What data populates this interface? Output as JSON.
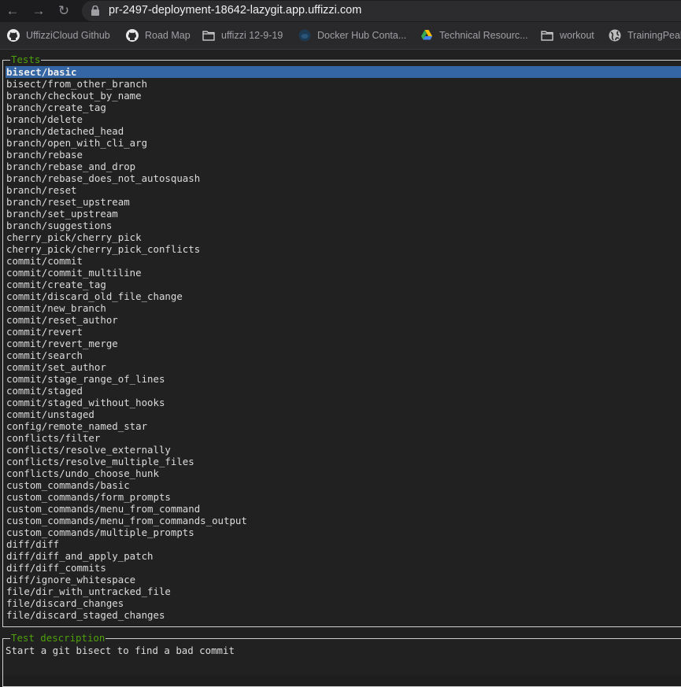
{
  "browser": {
    "url": "pr-2497-deployment-18642-lazygit.app.uffizzi.com",
    "nav": {
      "back": "back-icon",
      "forward": "forward-icon",
      "reload": "reload-icon"
    },
    "bookmarks": [
      {
        "label": "UffizziCloud Github",
        "icon": "github-icon"
      },
      {
        "label": "Road Map",
        "icon": "github-icon"
      },
      {
        "label": "uffizzi 12-9-19",
        "icon": "folder-icon"
      },
      {
        "label": "Docker Hub Conta...",
        "icon": "docker-icon"
      },
      {
        "label": "Technical Resourc...",
        "icon": "google-drive-icon"
      },
      {
        "label": "workout",
        "icon": "folder-icon"
      },
      {
        "label": "TrainingPeaks",
        "icon": "globe-icon"
      }
    ]
  },
  "tests_panel": {
    "title": "Tests",
    "selected_index": 0,
    "items": [
      "bisect/basic",
      "bisect/from_other_branch",
      "branch/checkout_by_name",
      "branch/create_tag",
      "branch/delete",
      "branch/detached_head",
      "branch/open_with_cli_arg",
      "branch/rebase",
      "branch/rebase_and_drop",
      "branch/rebase_does_not_autosquash",
      "branch/reset",
      "branch/reset_upstream",
      "branch/set_upstream",
      "branch/suggestions",
      "cherry_pick/cherry_pick",
      "cherry_pick/cherry_pick_conflicts",
      "commit/commit",
      "commit/commit_multiline",
      "commit/create_tag",
      "commit/discard_old_file_change",
      "commit/new_branch",
      "commit/reset_author",
      "commit/revert",
      "commit/revert_merge",
      "commit/search",
      "commit/set_author",
      "commit/stage_range_of_lines",
      "commit/staged",
      "commit/staged_without_hooks",
      "commit/unstaged",
      "config/remote_named_star",
      "conflicts/filter",
      "conflicts/resolve_externally",
      "conflicts/resolve_multiple_files",
      "conflicts/undo_choose_hunk",
      "custom_commands/basic",
      "custom_commands/form_prompts",
      "custom_commands/menu_from_command",
      "custom_commands/menu_from_commands_output",
      "custom_commands/multiple_prompts",
      "diff/diff",
      "diff/diff_and_apply_patch",
      "diff/diff_commits",
      "diff/ignore_whitespace",
      "file/dir_with_untracked_file",
      "file/discard_changes",
      "file/discard_staged_changes"
    ]
  },
  "description_panel": {
    "title": "Test description",
    "text": "Start a git bisect to find a bad commit"
  },
  "colors": {
    "panel_title": "#4fa10c",
    "selection_bg": "#3465a4",
    "border": "#d0d0d0",
    "terminal_bg": "#212121"
  }
}
